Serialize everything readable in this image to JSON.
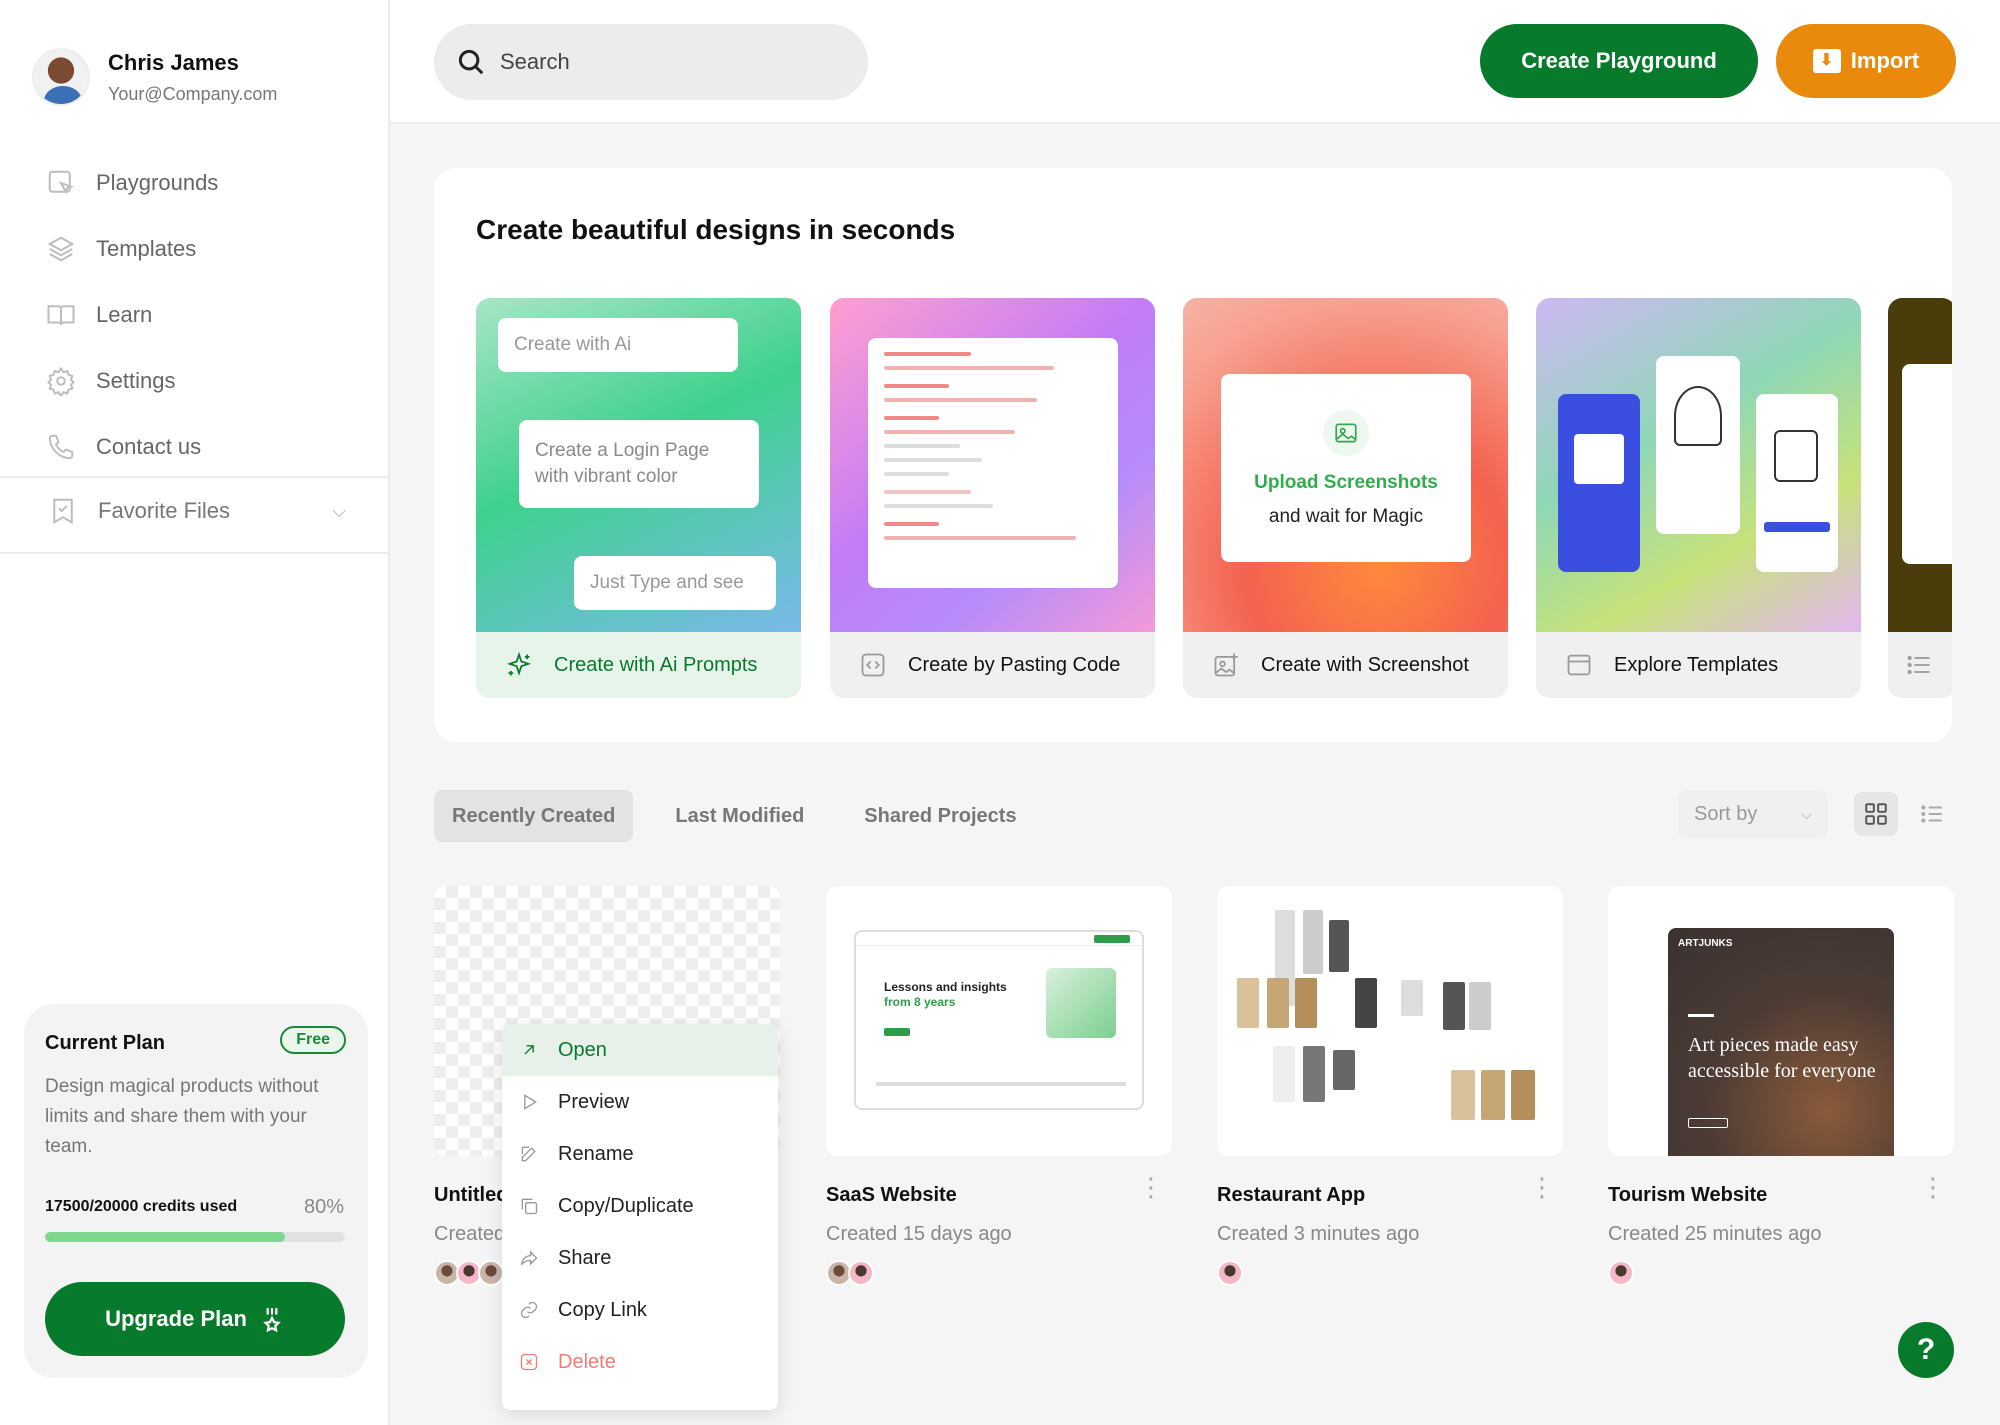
{
  "profile": {
    "name": "Chris James",
    "email": "Your@Company.com"
  },
  "nav": [
    {
      "label": "Playgrounds",
      "icon": "playground-icon"
    },
    {
      "label": "Templates",
      "icon": "layers-icon"
    },
    {
      "label": "Learn",
      "icon": "book-icon"
    },
    {
      "label": "Settings",
      "icon": "gear-icon"
    },
    {
      "label": "Contact us",
      "icon": "phone-icon"
    }
  ],
  "favorites": {
    "label": "Favorite Files"
  },
  "plan": {
    "title": "Current Plan",
    "badge": "Free",
    "description": "Design magical products without limits and share them with your team.",
    "credits_label": "17500/20000 credits used",
    "percent_label": "80%",
    "progress_fraction": 0.8,
    "upgrade_label": "Upgrade Plan"
  },
  "topbar": {
    "search_placeholder": "Search",
    "create_label": "Create Playground",
    "import_label": "Import"
  },
  "hero": {
    "title": "Create beautiful designs in seconds",
    "cards": [
      {
        "label": "Create with Ai Prompts",
        "bubbles": [
          "Create with Ai",
          "Create a Login Page with vibrant color",
          "Just Type and see"
        ]
      },
      {
        "label": "Create by Pasting Code"
      },
      {
        "label": "Create with Screenshot",
        "upload_line1": "Upload Screenshots",
        "upload_line2": "and wait for Magic"
      },
      {
        "label": "Explore Templates"
      }
    ]
  },
  "tabs": [
    "Recently Created",
    "Last Modified",
    "Shared Projects"
  ],
  "sort_label": "Sort by",
  "projects": [
    {
      "title": "Untitled",
      "subtitle": "Created"
    },
    {
      "title": "SaaS Website",
      "subtitle": "Created 15 days ago",
      "site_headline": "Lessons and insights",
      "site_highlight": "from 8 years"
    },
    {
      "title": "Restaurant App",
      "subtitle": "Created 3 minutes ago"
    },
    {
      "title": "Tourism Website",
      "subtitle": "Created 25 minutes ago",
      "site_logo": "ARTJUNKS",
      "site_headline": "Art pieces made easy accessible for everyone"
    }
  ],
  "context_menu": [
    "Open",
    "Preview",
    "Rename",
    "Copy/Duplicate",
    "Share",
    "Copy Link",
    "Delete"
  ],
  "help_label": "?",
  "colors": {
    "brand_green": "#087a2c",
    "import_orange": "#ea8a0c",
    "delete_red": "#f07c75"
  }
}
